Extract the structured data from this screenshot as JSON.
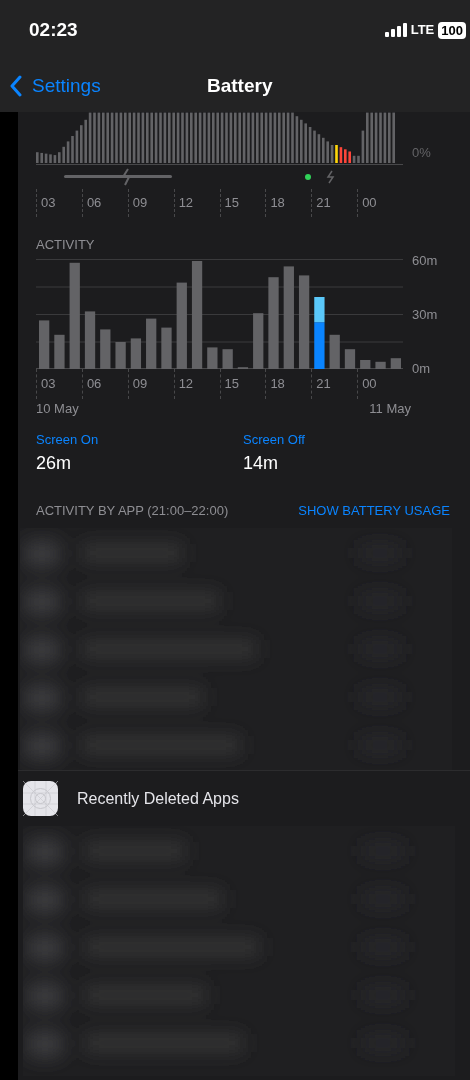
{
  "status_bar": {
    "time": "02:23",
    "network": "LTE",
    "battery": "100"
  },
  "nav": {
    "back": "Settings",
    "title": "Battery"
  },
  "battery_level": {
    "kind": "picture",
    "ytick": "0%",
    "xticks": [
      "03",
      "06",
      "09",
      "12",
      "15",
      "18",
      "21",
      "00"
    ]
  },
  "activity": {
    "title": "ACTIVITY",
    "dates": [
      "10 May",
      "11 May"
    ],
    "chart_data": {
      "type": "bar",
      "stacked": true,
      "x": [
        3,
        4,
        5,
        6,
        7,
        8,
        9,
        10,
        11,
        12,
        13,
        14,
        15,
        16,
        17,
        18,
        19,
        20,
        21,
        22,
        23,
        24,
        25,
        26
      ],
      "xlim": [
        2.5,
        26.5
      ],
      "series": [
        {
          "color": "#636366",
          "values": [
            27,
            19,
            59,
            32,
            22,
            15,
            17,
            28,
            23,
            48,
            60,
            12,
            11,
            1,
            31,
            51,
            57,
            52,
            null,
            19,
            11,
            5,
            4,
            6
          ]
        },
        {
          "color": "#0a84ff",
          "values": [
            null,
            null,
            null,
            null,
            null,
            null,
            null,
            null,
            null,
            null,
            null,
            null,
            null,
            null,
            null,
            null,
            null,
            null,
            26,
            null,
            null,
            null,
            null,
            null
          ]
        },
        {
          "color": "#5ac8fa",
          "values": [
            null,
            null,
            null,
            null,
            null,
            null,
            null,
            null,
            null,
            null,
            null,
            null,
            null,
            null,
            null,
            null,
            null,
            null,
            14,
            null,
            null,
            null,
            null,
            null
          ]
        }
      ],
      "ylim": [
        0,
        60
      ],
      "yticks": [
        {
          "value": 0,
          "label": "0m"
        },
        {
          "value": 30,
          "label": "30m"
        },
        {
          "value": 60,
          "label": "60m"
        }
      ],
      "xticks": [
        {
          "value": 3,
          "label": "03"
        },
        {
          "value": 6,
          "label": "06"
        },
        {
          "value": 9,
          "label": "09"
        },
        {
          "value": 12,
          "label": "12"
        },
        {
          "value": 15,
          "label": "15"
        },
        {
          "value": 18,
          "label": "18"
        },
        {
          "value": 21,
          "label": "21"
        }
      ]
    },
    "midnight_tick": "00"
  },
  "screen_time": [
    {
      "label": "Screen On",
      "value": "26m"
    },
    {
      "label": "Screen Off",
      "value": "14m"
    }
  ],
  "activity_by_app": {
    "header": "ACTIVITY BY APP (21:00–22:00)",
    "link": "SHOW BATTERY USAGE"
  },
  "recently_deleted": {
    "label": "Recently Deleted Apps"
  }
}
